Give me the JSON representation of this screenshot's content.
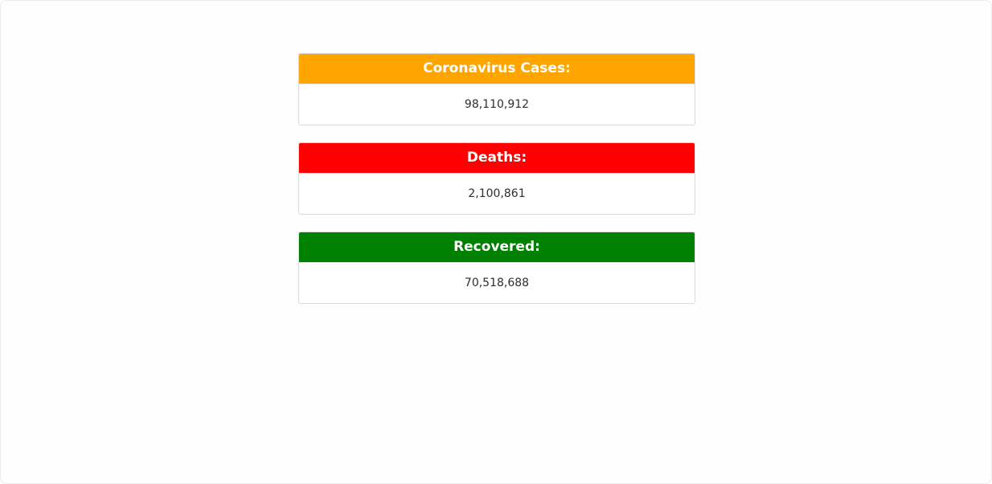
{
  "colors": {
    "cases": "#FFA500",
    "deaths": "#FF0000",
    "recovered": "#008000"
  },
  "cards": [
    {
      "title": "Coronavirus Cases:",
      "value": "98,110,912"
    },
    {
      "title": "Deaths:",
      "value": "2,100,861"
    },
    {
      "title": "Recovered:",
      "value": "70,518,688"
    }
  ]
}
